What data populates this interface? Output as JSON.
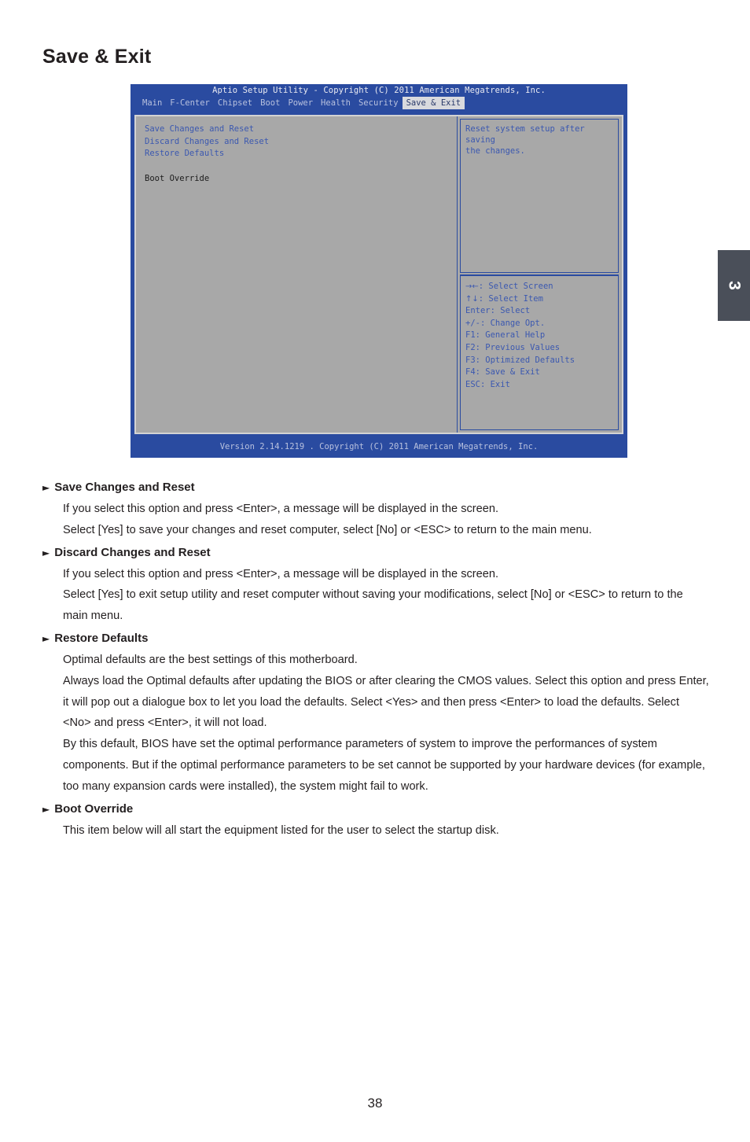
{
  "page": {
    "title": "Save & Exit",
    "chapter_tab": "3",
    "number": "38"
  },
  "bios": {
    "titlebar": "Aptio Setup Utility - Copyright (C) 2011 American Megatrends, Inc.",
    "menu_tabs": [
      {
        "label": "Main",
        "active": false
      },
      {
        "label": "F-Center",
        "active": false
      },
      {
        "label": "Chipset",
        "active": false
      },
      {
        "label": "Boot",
        "active": false
      },
      {
        "label": "Power",
        "active": false
      },
      {
        "label": "Health",
        "active": false
      },
      {
        "label": "Security",
        "active": false
      },
      {
        "label": "Save & Exit",
        "active": true
      }
    ],
    "options": [
      {
        "label": "Save Changes and Reset",
        "style": "link"
      },
      {
        "label": "Discard Changes and Reset",
        "style": "link"
      },
      {
        "label": "Restore Defaults",
        "style": "link"
      },
      {
        "label": "Boot Override",
        "style": "plain"
      }
    ],
    "help_text": [
      "Reset system setup after saving",
      "the changes."
    ],
    "legend": [
      {
        "keys": "→←",
        "text": ": Select Screen"
      },
      {
        "keys": "↑↓",
        "text": ": Select Item"
      },
      {
        "keys": "",
        "text": "Enter: Select"
      },
      {
        "keys": "",
        "text": "+/-: Change Opt."
      },
      {
        "keys": "",
        "text": "F1: General Help"
      },
      {
        "keys": "",
        "text": "F2: Previous Values"
      },
      {
        "keys": "",
        "text": "F3: Optimized Defaults"
      },
      {
        "keys": "",
        "text": "F4: Save & Exit"
      },
      {
        "keys": "",
        "text": "ESC: Exit"
      }
    ],
    "footer": "Version 2.14.1219 . Copyright (C) 2011 American Megatrends, Inc."
  },
  "sections": [
    {
      "heading": "Save Changes and Reset",
      "paragraphs": [
        "If you select this option and press <Enter>, a message will be displayed in the screen.",
        "Select [Yes] to save your changes and reset computer, select [No] or <ESC> to return to the main menu."
      ]
    },
    {
      "heading": "Discard Changes and Reset",
      "paragraphs": [
        "If you select this option and press <Enter>,  a message will be displayed in the screen.",
        "Select [Yes] to exit setup utility and reset computer without saving your modifications, select [No] or <ESC> to return to the main menu."
      ]
    },
    {
      "heading": "Restore Defaults",
      "paragraphs": [
        "Optimal defaults are the best settings of this motherboard.",
        "Always load the Optimal defaults after updating the BIOS or after clearing the CMOS values. Select this option and press Enter, it will pop out a dialogue box to let you load the defaults. Select <Yes> and then press <Enter> to load the defaults. Select <No> and press <Enter>, it will not load.",
        "By this default, BIOS have set the optimal performance parameters of system to improve the performances of system components. But if the optimal performance parameters to be set cannot be supported by your hardware devices (for example, too many expansion cards were installed), the system might fail to work."
      ]
    },
    {
      "heading": "Boot Override",
      "paragraphs": [
        "This item below will all start the equipment listed for the user to select the startup disk."
      ]
    }
  ],
  "colors": {
    "bios_blue": "#2a4ba0",
    "bios_panel": "#a8a8a8",
    "bios_text_blue": "#3b58b0",
    "chapter_tab": "#4a4f59"
  }
}
